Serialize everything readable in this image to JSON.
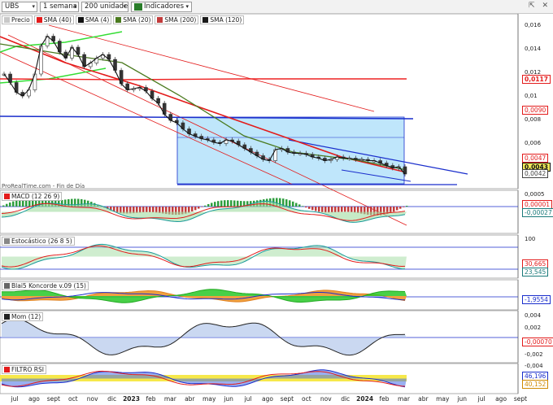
{
  "toolbar": {
    "symbol": "UBS",
    "period": "1 semana",
    "units": "200 unidades",
    "indicators_label": "Indicadores",
    "window_icons": "⇱ ✕"
  },
  "price_legend": [
    {
      "label": "Precio",
      "color": "#c8c8c8"
    },
    {
      "label": "SMA (40)",
      "color": "#e31b1b"
    },
    {
      "label": "SMA (4)",
      "color": "#111111"
    },
    {
      "label": "SMA (20)",
      "color": "#4a7a1e"
    },
    {
      "label": "SMA (200)",
      "color": "#c23c3c"
    },
    {
      "label": "SMA (120)",
      "color": "#1a1a1a"
    }
  ],
  "watermark": "ProRealTime.com - Fin de Día",
  "price_axis": [
    "0,016",
    "0,014",
    "0,012",
    "0,01",
    "0,008",
    "0,006",
    "0,004"
  ],
  "price_tags": [
    {
      "text": "0,0117",
      "color": "#e31b1b",
      "bg": "#ffffff",
      "bold": true
    },
    {
      "text": "0,0090",
      "color": "#e31b1b",
      "bg": "#ffffff",
      "bold": false
    },
    {
      "text": "0,0047",
      "color": "#e31b1b",
      "bg": "#ffffff",
      "bold": false
    },
    {
      "text": "0,0043",
      "color": "#111111",
      "bg": "#f2e95a",
      "bold": true
    },
    {
      "text": "0,0042",
      "color": "#444444",
      "bg": "#ffffff",
      "bold": false
    }
  ],
  "macd": {
    "title": "MACD (12 26 9)",
    "axis": [
      "0,0005"
    ],
    "tags": [
      "0,00001",
      "-0,00027"
    ]
  },
  "stoch": {
    "title": "Estocástico (26 8 5)",
    "axis": [
      "100"
    ],
    "tags": [
      "30,665",
      "23,545"
    ]
  },
  "koncorde": {
    "title": "Blai5 Koncorde v.09 (15)",
    "tags": [
      "-1,9554"
    ]
  },
  "mom": {
    "title": "Mom (12)",
    "axis": [
      "0,004",
      "0,002",
      "-0,002",
      "-0,004"
    ],
    "tags": [
      "-0,00070"
    ]
  },
  "rsi": {
    "title": "FILTRO RSI",
    "tags": [
      "46,196",
      "40,152"
    ]
  },
  "x_labels": [
    {
      "t": "jul",
      "b": false
    },
    {
      "t": "ago",
      "b": false
    },
    {
      "t": "sept",
      "b": false
    },
    {
      "t": "oct",
      "b": false
    },
    {
      "t": "nov",
      "b": false
    },
    {
      "t": "dic",
      "b": false
    },
    {
      "t": "2023",
      "b": true
    },
    {
      "t": "feb",
      "b": false
    },
    {
      "t": "mar",
      "b": false
    },
    {
      "t": "abr",
      "b": false
    },
    {
      "t": "may",
      "b": false
    },
    {
      "t": "jun",
      "b": false
    },
    {
      "t": "jul",
      "b": false
    },
    {
      "t": "ago",
      "b": false
    },
    {
      "t": "sept",
      "b": false
    },
    {
      "t": "oct",
      "b": false
    },
    {
      "t": "nov",
      "b": false
    },
    {
      "t": "dic",
      "b": false
    },
    {
      "t": "2024",
      "b": true
    },
    {
      "t": "feb",
      "b": false
    },
    {
      "t": "mar",
      "b": false
    },
    {
      "t": "abr",
      "b": false
    },
    {
      "t": "may",
      "b": false
    },
    {
      "t": "jun",
      "b": false
    },
    {
      "t": "jul",
      "b": false
    },
    {
      "t": "ago",
      "b": false
    },
    {
      "t": "sept",
      "b": false
    }
  ],
  "colors": {
    "sma40": "#e31b1b",
    "sma20": "#4a7a1e",
    "sma120": "#1a1a1a",
    "channel": "#e31b1b",
    "blue": "#1a2ecc",
    "box": "#bfe6fb",
    "green_ch": "#33dd33"
  },
  "price_series": [
    0.0125,
    0.0118,
    0.011,
    0.0107,
    0.0112,
    0.0125,
    0.0148,
    0.0156,
    0.0152,
    0.0143,
    0.0138,
    0.0147,
    0.0141,
    0.0131,
    0.0134,
    0.0138,
    0.0141,
    0.0137,
    0.0128,
    0.0117,
    0.0112,
    0.0113,
    0.0114,
    0.0111,
    0.0105,
    0.0101,
    0.0092,
    0.0087,
    0.0085,
    0.008,
    0.0076,
    0.0074,
    0.0072,
    0.0071,
    0.0069,
    0.0068,
    0.0071,
    0.007,
    0.0067,
    0.0064,
    0.0061,
    0.0058,
    0.0055,
    0.0054,
    0.0063,
    0.0064,
    0.0061,
    0.006,
    0.006,
    0.0059,
    0.0057,
    0.0056,
    0.0054,
    0.0055,
    0.0057,
    0.0056,
    0.0056,
    0.0055,
    0.0055,
    0.0054,
    0.0054,
    0.0052,
    0.005,
    0.0048,
    0.0049,
    0.0043
  ]
}
